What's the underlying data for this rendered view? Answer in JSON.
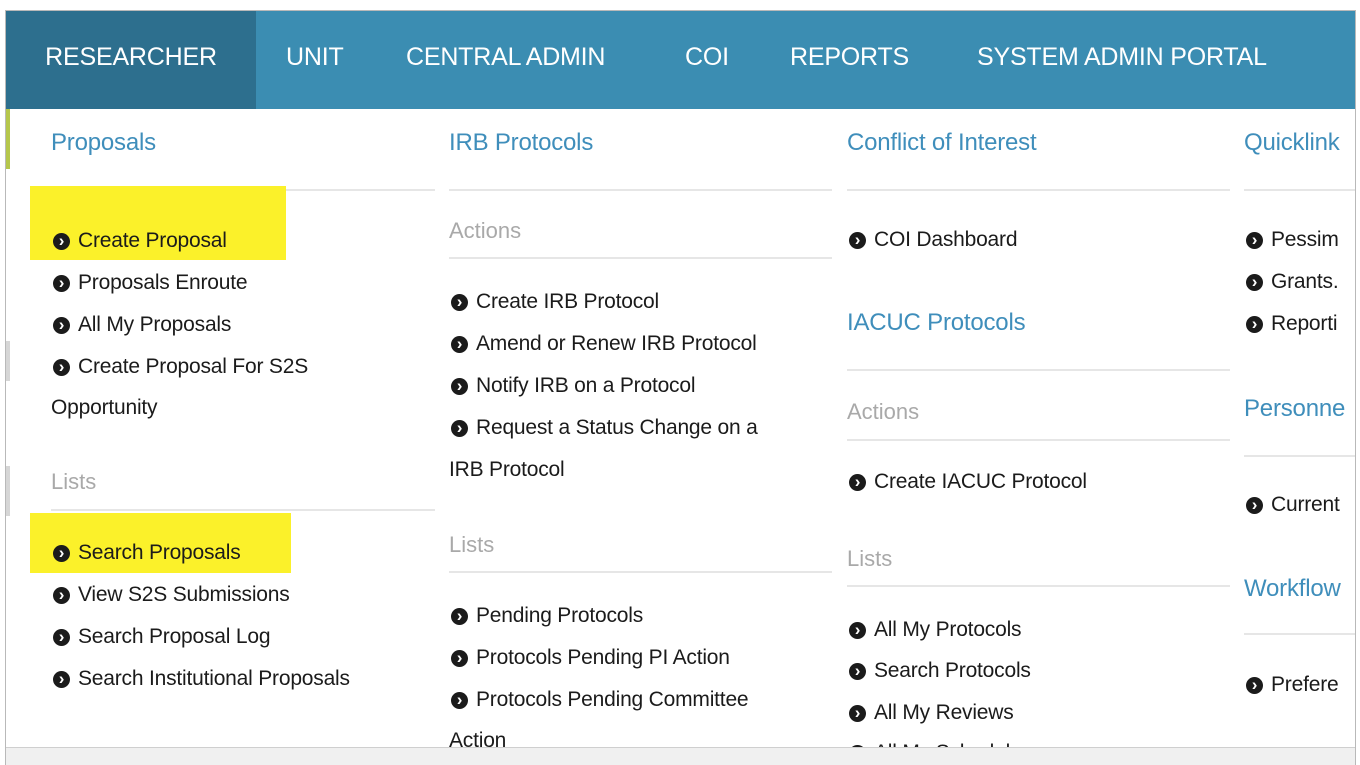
{
  "topnav": {
    "tabs": [
      {
        "label": "RESEARCHER",
        "active": true
      },
      {
        "label": "UNIT"
      },
      {
        "label": "CENTRAL ADMIN"
      },
      {
        "label": "COI"
      },
      {
        "label": "REPORTS"
      },
      {
        "label": "SYSTEM ADMIN PORTAL"
      }
    ]
  },
  "colors": {
    "nav_bg": "#3b8db2",
    "nav_active_bg": "#2d6f8e",
    "heading": "#3f8ebb",
    "highlight": "#fbf12a"
  },
  "proposals": {
    "heading": "Proposals",
    "actions": [
      "Create Proposal",
      "Proposals Enroute",
      "All My Proposals",
      "Create Proposal For S2S"
    ],
    "actions_wrap": "Opportunity",
    "lists_label": "Lists",
    "lists": [
      "Search Proposals",
      "View S2S Submissions",
      "Search Proposal Log",
      "Search Institutional Proposals"
    ]
  },
  "irb": {
    "heading": "IRB Protocols",
    "actions_label": "Actions",
    "actions": [
      "Create IRB Protocol",
      "Amend or Renew IRB Protocol",
      "Notify IRB on a Protocol",
      "Request a Status Change on a"
    ],
    "actions_wrap": "IRB Protocol",
    "lists_label": "Lists",
    "lists": [
      "Pending Protocols",
      "Protocols Pending PI Action",
      "Protocols Pending Committee"
    ],
    "lists_wrap": "Action"
  },
  "coi": {
    "heading": "Conflict of Interest",
    "items": [
      "COI Dashboard"
    ]
  },
  "iacuc": {
    "heading": "IACUC Protocols",
    "actions_label": "Actions",
    "actions": [
      "Create IACUC Protocol"
    ],
    "lists_label": "Lists",
    "lists": [
      "All My Protocols",
      "Search Protocols",
      "All My Reviews",
      "All My Schedules"
    ]
  },
  "quicklinks": {
    "heading": "Quicklink",
    "items": [
      "Pessim",
      "Grants.",
      "Reporti"
    ]
  },
  "personnel": {
    "heading": "Personne",
    "items": [
      "Current"
    ]
  },
  "workflow": {
    "heading": "Workflow",
    "items": [
      "Prefere"
    ]
  }
}
